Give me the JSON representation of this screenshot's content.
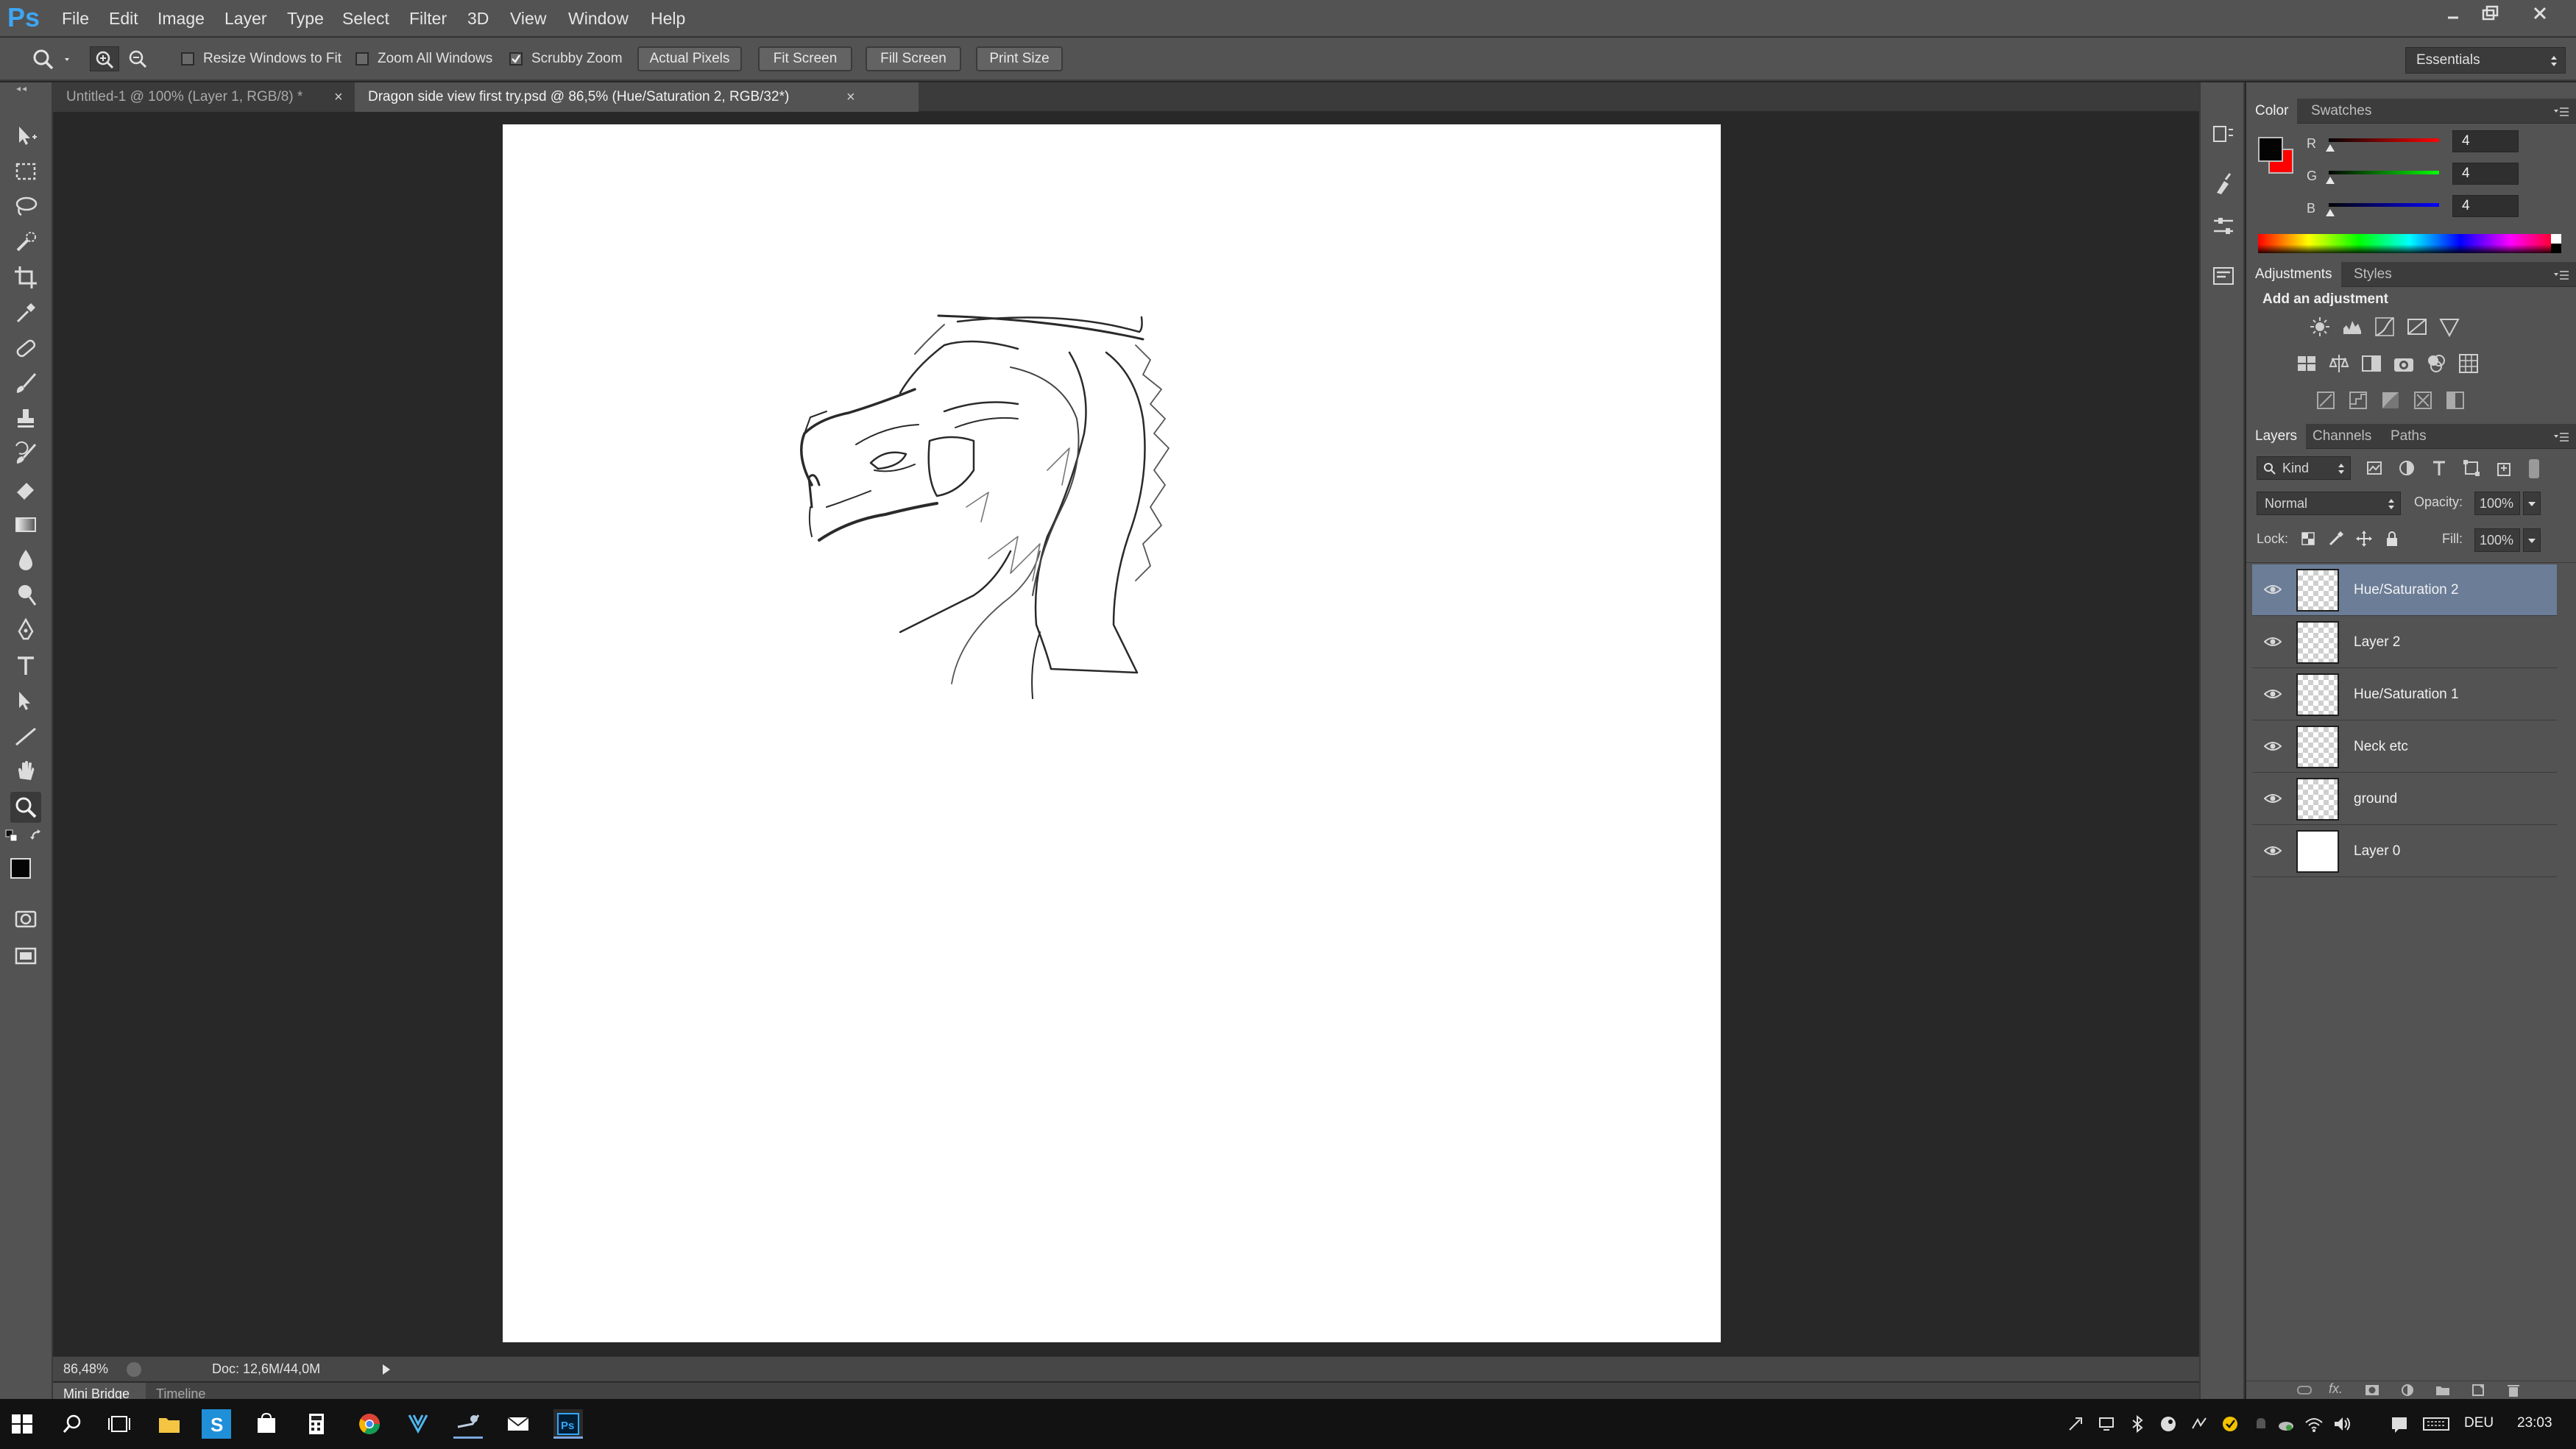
{
  "app": {
    "logo": "Ps",
    "accent": "#3ea6f2"
  },
  "menu": [
    "File",
    "Edit",
    "Image",
    "Layer",
    "Type",
    "Select",
    "Filter",
    "3D",
    "View",
    "Window",
    "Help"
  ],
  "options": {
    "resize_windows": "Resize Windows to Fit",
    "zoom_all": "Zoom All Windows",
    "scrubby_zoom": "Scrubby Zoom",
    "scrubby_checked": true,
    "actual_pixels": "Actual Pixels",
    "fit_screen": "Fit Screen",
    "fill_screen": "Fill Screen",
    "print_size": "Print Size",
    "workspace": "Essentials"
  },
  "tabs": [
    {
      "label": "Untitled-1 @ 100% (Layer 1, RGB/8) *",
      "active": false
    },
    {
      "label": "Dragon side view first try.psd @ 86,5% (Hue/Saturation 2, RGB/32*)",
      "active": true
    }
  ],
  "status": {
    "zoom": "86,48%",
    "doc": "Doc: 12,6M/44,0M"
  },
  "bottom_tabs": [
    "Mini Bridge",
    "Timeline"
  ],
  "color_panel": {
    "tabs": [
      "Color",
      "Swatches"
    ],
    "fg": "#040404",
    "bg": "#ff0000",
    "channels": [
      {
        "label": "R",
        "value": "4",
        "color": "#e02020"
      },
      {
        "label": "G",
        "value": "4",
        "color": "#20c020"
      },
      {
        "label": "B",
        "value": "4",
        "color": "#2040e0"
      }
    ]
  },
  "adjustments": {
    "tabs": [
      "Adjustments",
      "Styles"
    ],
    "title": "Add an adjustment"
  },
  "layers_panel": {
    "tabs": [
      "Layers",
      "Channels",
      "Paths"
    ],
    "filter": "Kind",
    "blend_mode": "Normal",
    "opacity_label": "Opacity:",
    "opacity": "100%",
    "lock_label": "Lock:",
    "fill_label": "Fill:",
    "fill": "100%",
    "layers": [
      {
        "name": "Hue/Saturation 2",
        "selected": true,
        "solid": false
      },
      {
        "name": "Layer 2",
        "selected": false,
        "solid": false
      },
      {
        "name": "Hue/Saturation 1",
        "selected": false,
        "solid": false
      },
      {
        "name": "Neck etc",
        "selected": false,
        "solid": false
      },
      {
        "name": "ground",
        "selected": false,
        "solid": false
      },
      {
        "name": "Layer 0",
        "selected": false,
        "solid": true
      }
    ]
  },
  "taskbar": {
    "language": "DEU",
    "time": "23:03"
  }
}
